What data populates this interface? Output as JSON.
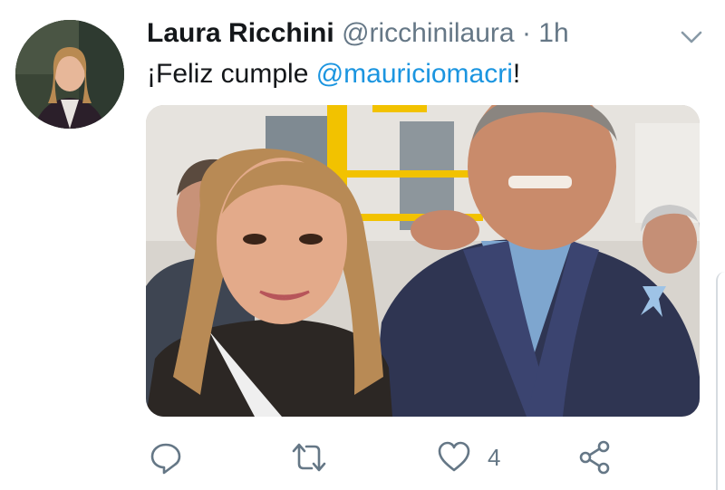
{
  "tweet": {
    "author_name": "Laura Ricchini",
    "author_handle": "@ricchinilaura",
    "separator": "·",
    "time": "1h",
    "text_prefix": "¡Feliz cumple ",
    "mention": "@mauriciomacri",
    "text_suffix": "!"
  },
  "actions": {
    "reply_count": "",
    "retweet_count": "",
    "like_count": "4"
  },
  "colors": {
    "link": "#1b95e0",
    "muted": "#657786",
    "text": "#14171a"
  },
  "icons": [
    "chevron-down-icon",
    "reply-icon",
    "retweet-icon",
    "heart-icon",
    "share-icon"
  ]
}
